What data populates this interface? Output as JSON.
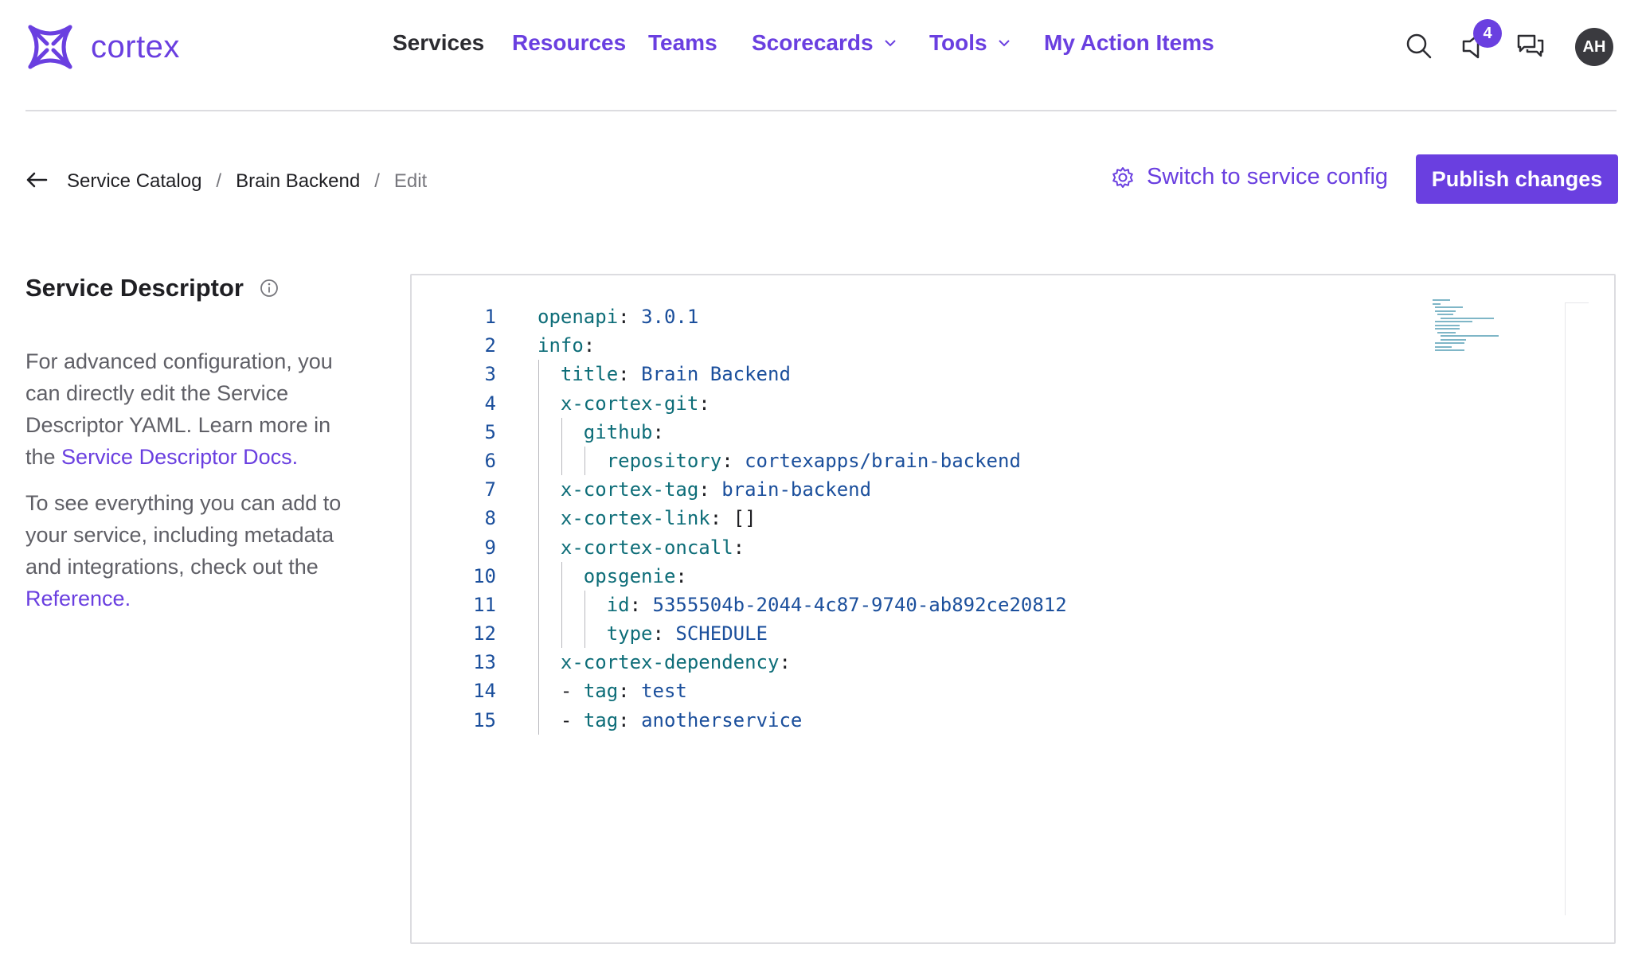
{
  "logo": {
    "text": "cortex"
  },
  "nav": [
    {
      "label": "Services",
      "active": true
    },
    {
      "label": "Resources"
    },
    {
      "label": "Teams"
    },
    {
      "label": "Scorecards",
      "dropdown": true
    },
    {
      "label": "Tools",
      "dropdown": true
    },
    {
      "label": "My Action Items"
    }
  ],
  "header": {
    "notification_count": "4",
    "avatar_initials": "AH",
    "icons": [
      "search-icon",
      "notifications-icon",
      "chat-icon"
    ]
  },
  "breadcrumb": {
    "items": [
      "Service Catalog",
      "Brain Backend",
      "Edit"
    ],
    "separator": "/"
  },
  "toolbar": {
    "switch_label": "Switch to service config",
    "publish_label": "Publish changes"
  },
  "panel": {
    "title": "Service Descriptor",
    "desc1_text": "For advanced configuration, you can directly edit the Service Descriptor YAML. Learn more in the ",
    "desc1_link": "Service Descriptor Docs",
    "desc1_end": ".",
    "desc2_text": "To see everything you can add to your service, including metadata and integrations, check out the ",
    "desc2_link": "Reference",
    "desc2_end": "."
  },
  "editor": {
    "lines": [
      {
        "n": "1",
        "indent": "",
        "dash": "",
        "key": "openapi",
        "value": "3.0.1"
      },
      {
        "n": "2",
        "indent": "",
        "dash": "",
        "key": "info",
        "value": ""
      },
      {
        "n": "3",
        "indent": "  ",
        "dash": "",
        "key": "title",
        "value": "Brain Backend"
      },
      {
        "n": "4",
        "indent": "  ",
        "dash": "",
        "key": "x-cortex-git",
        "value": ""
      },
      {
        "n": "5",
        "indent": "    ",
        "dash": "",
        "key": "github",
        "value": ""
      },
      {
        "n": "6",
        "indent": "      ",
        "dash": "",
        "key": "repository",
        "value": "cortexapps/brain-backend"
      },
      {
        "n": "7",
        "indent": "  ",
        "dash": "",
        "key": "x-cortex-tag",
        "value": "brain-backend"
      },
      {
        "n": "8",
        "indent": "  ",
        "dash": "",
        "key": "x-cortex-link",
        "value": "[]"
      },
      {
        "n": "9",
        "indent": "  ",
        "dash": "",
        "key": "x-cortex-oncall",
        "value": ""
      },
      {
        "n": "10",
        "indent": "    ",
        "dash": "",
        "key": "opsgenie",
        "value": ""
      },
      {
        "n": "11",
        "indent": "      ",
        "dash": "",
        "key": "id",
        "value": "5355504b-2044-4c87-9740-ab892ce20812"
      },
      {
        "n": "12",
        "indent": "      ",
        "dash": "",
        "key": "type",
        "value": "SCHEDULE"
      },
      {
        "n": "13",
        "indent": "  ",
        "dash": "",
        "key": "x-cortex-dependency",
        "value": ""
      },
      {
        "n": "14",
        "indent": "  ",
        "dash": "- ",
        "key": "tag",
        "value": "test"
      },
      {
        "n": "15",
        "indent": "  ",
        "dash": "- ",
        "key": "tag",
        "value": "anotherservice"
      }
    ]
  }
}
